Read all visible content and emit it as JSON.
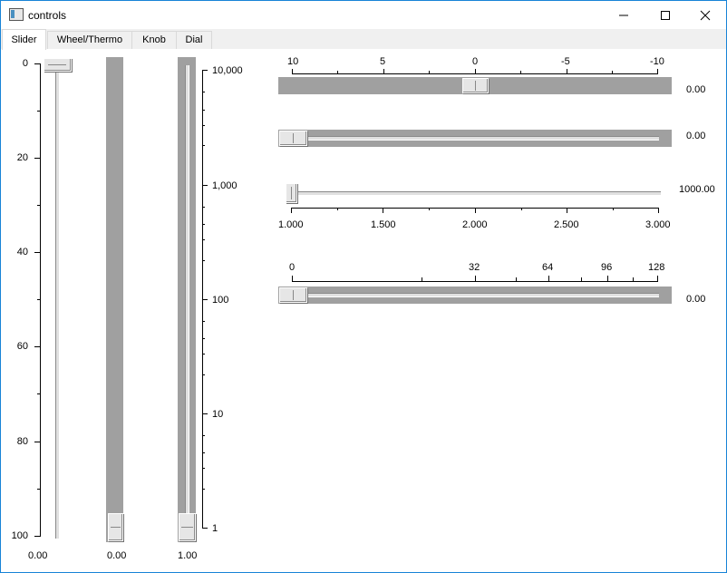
{
  "window": {
    "title": "controls",
    "minimize": "—",
    "maximize": "☐",
    "close": "✕"
  },
  "tabs": [
    {
      "label": "Slider"
    },
    {
      "label": "Wheel/Thermo"
    },
    {
      "label": "Knob"
    },
    {
      "label": "Dial"
    }
  ],
  "vertical": {
    "slider1": {
      "scale": [
        "0",
        "20",
        "40",
        "60",
        "80",
        "100"
      ],
      "value": "0.00"
    },
    "slider2": {
      "value": "0.00"
    },
    "slider3": {
      "scale": [
        "10,000",
        "1,000",
        "100",
        "10",
        "1"
      ],
      "value": "1.00"
    }
  },
  "horizontal": {
    "slider1": {
      "scale": [
        "10",
        "5",
        "0",
        "-5",
        "-10"
      ],
      "value": "0.00"
    },
    "slider2": {
      "value": "0.00"
    },
    "slider3": {
      "scale": [
        "1.000",
        "1.500",
        "2.000",
        "2.500",
        "3.000"
      ],
      "value": "1000.00"
    },
    "slider4": {
      "scale": [
        "0",
        "32",
        "64",
        "96",
        "128"
      ],
      "value": "0.00"
    }
  }
}
